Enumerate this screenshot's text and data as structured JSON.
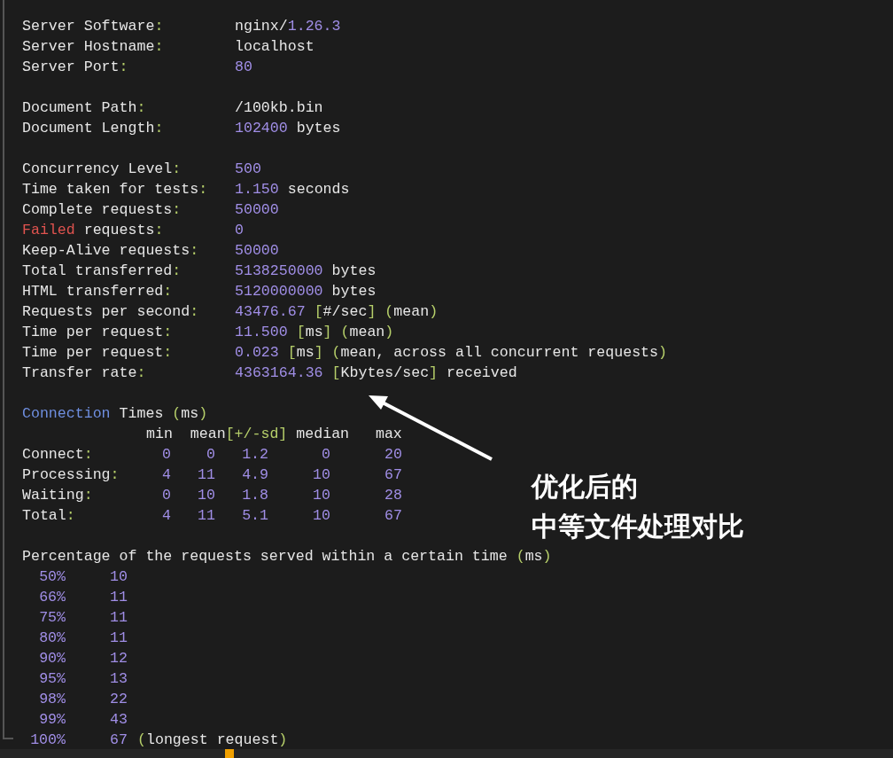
{
  "groups": [
    [
      {
        "label": [
          {
            "text": "Server Software",
            "kind": "plain"
          },
          {
            "text": ":",
            "kind": "accent"
          }
        ],
        "value": [
          {
            "text": "nginx/",
            "kind": "plain"
          },
          {
            "text": "1.26.3",
            "kind": "num"
          }
        ]
      },
      {
        "label": [
          {
            "text": "Server Hostname",
            "kind": "plain"
          },
          {
            "text": ":",
            "kind": "accent"
          }
        ],
        "value": [
          {
            "text": "localhost",
            "kind": "plain"
          }
        ]
      },
      {
        "label": [
          {
            "text": "Server Port",
            "kind": "plain"
          },
          {
            "text": ":",
            "kind": "accent"
          }
        ],
        "value": [
          {
            "text": "80",
            "kind": "num"
          }
        ]
      }
    ],
    [
      {
        "label": [
          {
            "text": "Document Path",
            "kind": "plain"
          },
          {
            "text": ":",
            "kind": "accent"
          }
        ],
        "value": [
          {
            "text": "/100kb.bin",
            "kind": "plain"
          }
        ]
      },
      {
        "label": [
          {
            "text": "Document Length",
            "kind": "plain"
          },
          {
            "text": ":",
            "kind": "accent"
          }
        ],
        "value": [
          {
            "text": "102400",
            "kind": "num"
          },
          {
            "text": " bytes",
            "kind": "plain"
          }
        ]
      }
    ],
    [
      {
        "label": [
          {
            "text": "Concurrency Level",
            "kind": "plain"
          },
          {
            "text": ":",
            "kind": "accent"
          }
        ],
        "value": [
          {
            "text": "500",
            "kind": "num"
          }
        ]
      },
      {
        "label": [
          {
            "text": "Time taken for tests",
            "kind": "plain"
          },
          {
            "text": ":",
            "kind": "accent"
          }
        ],
        "value": [
          {
            "text": "1.150",
            "kind": "num"
          },
          {
            "text": " seconds",
            "kind": "plain"
          }
        ]
      },
      {
        "label": [
          {
            "text": "Complete requests",
            "kind": "plain"
          },
          {
            "text": ":",
            "kind": "accent"
          }
        ],
        "value": [
          {
            "text": "50000",
            "kind": "num"
          }
        ]
      },
      {
        "label": [
          {
            "text": "Failed",
            "kind": "error"
          },
          {
            "text": " requests",
            "kind": "plain"
          },
          {
            "text": ":",
            "kind": "accent"
          }
        ],
        "value": [
          {
            "text": "0",
            "kind": "num"
          }
        ]
      },
      {
        "label": [
          {
            "text": "Keep-Alive requests",
            "kind": "plain"
          },
          {
            "text": ":",
            "kind": "accent"
          }
        ],
        "value": [
          {
            "text": "50000",
            "kind": "num"
          }
        ]
      },
      {
        "label": [
          {
            "text": "Total transferred",
            "kind": "plain"
          },
          {
            "text": ":",
            "kind": "accent"
          }
        ],
        "value": [
          {
            "text": "5138250000",
            "kind": "num"
          },
          {
            "text": " bytes",
            "kind": "plain"
          }
        ]
      },
      {
        "label": [
          {
            "text": "HTML transferred",
            "kind": "plain"
          },
          {
            "text": ":",
            "kind": "accent"
          }
        ],
        "value": [
          {
            "text": "5120000000",
            "kind": "num"
          },
          {
            "text": " bytes",
            "kind": "plain"
          }
        ]
      },
      {
        "label": [
          {
            "text": "Requests per second",
            "kind": "plain"
          },
          {
            "text": ":",
            "kind": "accent"
          }
        ],
        "value": [
          {
            "text": "43476.67",
            "kind": "num"
          },
          {
            "text": " [",
            "kind": "accent"
          },
          {
            "text": "#/sec",
            "kind": "plain"
          },
          {
            "text": "]",
            "kind": "accent"
          },
          {
            "text": " (",
            "kind": "accent"
          },
          {
            "text": "mean",
            "kind": "plain"
          },
          {
            "text": ")",
            "kind": "accent"
          }
        ]
      },
      {
        "label": [
          {
            "text": "Time per request",
            "kind": "plain"
          },
          {
            "text": ":",
            "kind": "accent"
          }
        ],
        "value": [
          {
            "text": "11.500",
            "kind": "num"
          },
          {
            "text": " [",
            "kind": "accent"
          },
          {
            "text": "ms",
            "kind": "plain"
          },
          {
            "text": "]",
            "kind": "accent"
          },
          {
            "text": " (",
            "kind": "accent"
          },
          {
            "text": "mean",
            "kind": "plain"
          },
          {
            "text": ")",
            "kind": "accent"
          }
        ]
      },
      {
        "label": [
          {
            "text": "Time per request",
            "kind": "plain"
          },
          {
            "text": ":",
            "kind": "accent"
          }
        ],
        "value": [
          {
            "text": "0.023",
            "kind": "num"
          },
          {
            "text": " [",
            "kind": "accent"
          },
          {
            "text": "ms",
            "kind": "plain"
          },
          {
            "text": "]",
            "kind": "accent"
          },
          {
            "text": " (",
            "kind": "accent"
          },
          {
            "text": "mean, across all concurrent requests",
            "kind": "plain"
          },
          {
            "text": ")",
            "kind": "accent"
          }
        ]
      },
      {
        "label": [
          {
            "text": "Transfer rate",
            "kind": "plain"
          },
          {
            "text": ":",
            "kind": "accent"
          }
        ],
        "value": [
          {
            "text": "4363164.36",
            "kind": "num"
          },
          {
            "text": " [",
            "kind": "accent"
          },
          {
            "text": "Kbytes/sec",
            "kind": "plain"
          },
          {
            "text": "]",
            "kind": "accent"
          },
          {
            "text": " received",
            "kind": "plain"
          }
        ]
      }
    ]
  ],
  "connection_times": {
    "title": [
      {
        "text": "Connection",
        "kind": "heading"
      },
      {
        "text": " Times ",
        "kind": "plain"
      },
      {
        "text": "(",
        "kind": "accent"
      },
      {
        "text": "ms",
        "kind": "plain"
      },
      {
        "text": ")",
        "kind": "accent"
      }
    ],
    "header": [
      {
        "text": "min  mean",
        "kind": "plain"
      },
      {
        "text": "[+/-sd]",
        "kind": "accent"
      },
      {
        "text": " median   max",
        "kind": "plain"
      }
    ],
    "rows": [
      {
        "label": [
          {
            "text": "Connect",
            "kind": "plain"
          },
          {
            "text": ":",
            "kind": "accent"
          }
        ],
        "cells": [
          "0",
          "0",
          "1.2",
          "0",
          "20"
        ]
      },
      {
        "label": [
          {
            "text": "Processing",
            "kind": "plain"
          },
          {
            "text": ":",
            "kind": "accent"
          }
        ],
        "cells": [
          "4",
          "11",
          "4.9",
          "10",
          "67"
        ]
      },
      {
        "label": [
          {
            "text": "Waiting",
            "kind": "plain"
          },
          {
            "text": ":",
            "kind": "accent"
          }
        ],
        "cells": [
          "0",
          "10",
          "1.8",
          "10",
          "28"
        ]
      },
      {
        "label": [
          {
            "text": "Total",
            "kind": "plain"
          },
          {
            "text": ":",
            "kind": "accent"
          }
        ],
        "cells": [
          "4",
          "11",
          "5.1",
          "10",
          "67"
        ]
      }
    ]
  },
  "percentages": {
    "title": [
      {
        "text": "Percentage of the requests served within a certain time ",
        "kind": "plain"
      },
      {
        "text": "(",
        "kind": "accent"
      },
      {
        "text": "ms",
        "kind": "plain"
      },
      {
        "text": ")",
        "kind": "accent"
      }
    ],
    "rows": [
      {
        "percent": "50%",
        "value": "10"
      },
      {
        "percent": "66%",
        "value": "11"
      },
      {
        "percent": "75%",
        "value": "11"
      },
      {
        "percent": "80%",
        "value": "11"
      },
      {
        "percent": "90%",
        "value": "12"
      },
      {
        "percent": "95%",
        "value": "13"
      },
      {
        "percent": "98%",
        "value": "22"
      },
      {
        "percent": "99%",
        "value": "43"
      },
      {
        "percent": "100%",
        "value": "67",
        "note": [
          {
            "text": "(",
            "kind": "accent"
          },
          {
            "text": "longest request",
            "kind": "plain"
          },
          {
            "text": ")",
            "kind": "accent"
          }
        ]
      }
    ]
  },
  "annotation": {
    "lines": [
      "优化后的",
      "中等文件处理对比"
    ]
  }
}
